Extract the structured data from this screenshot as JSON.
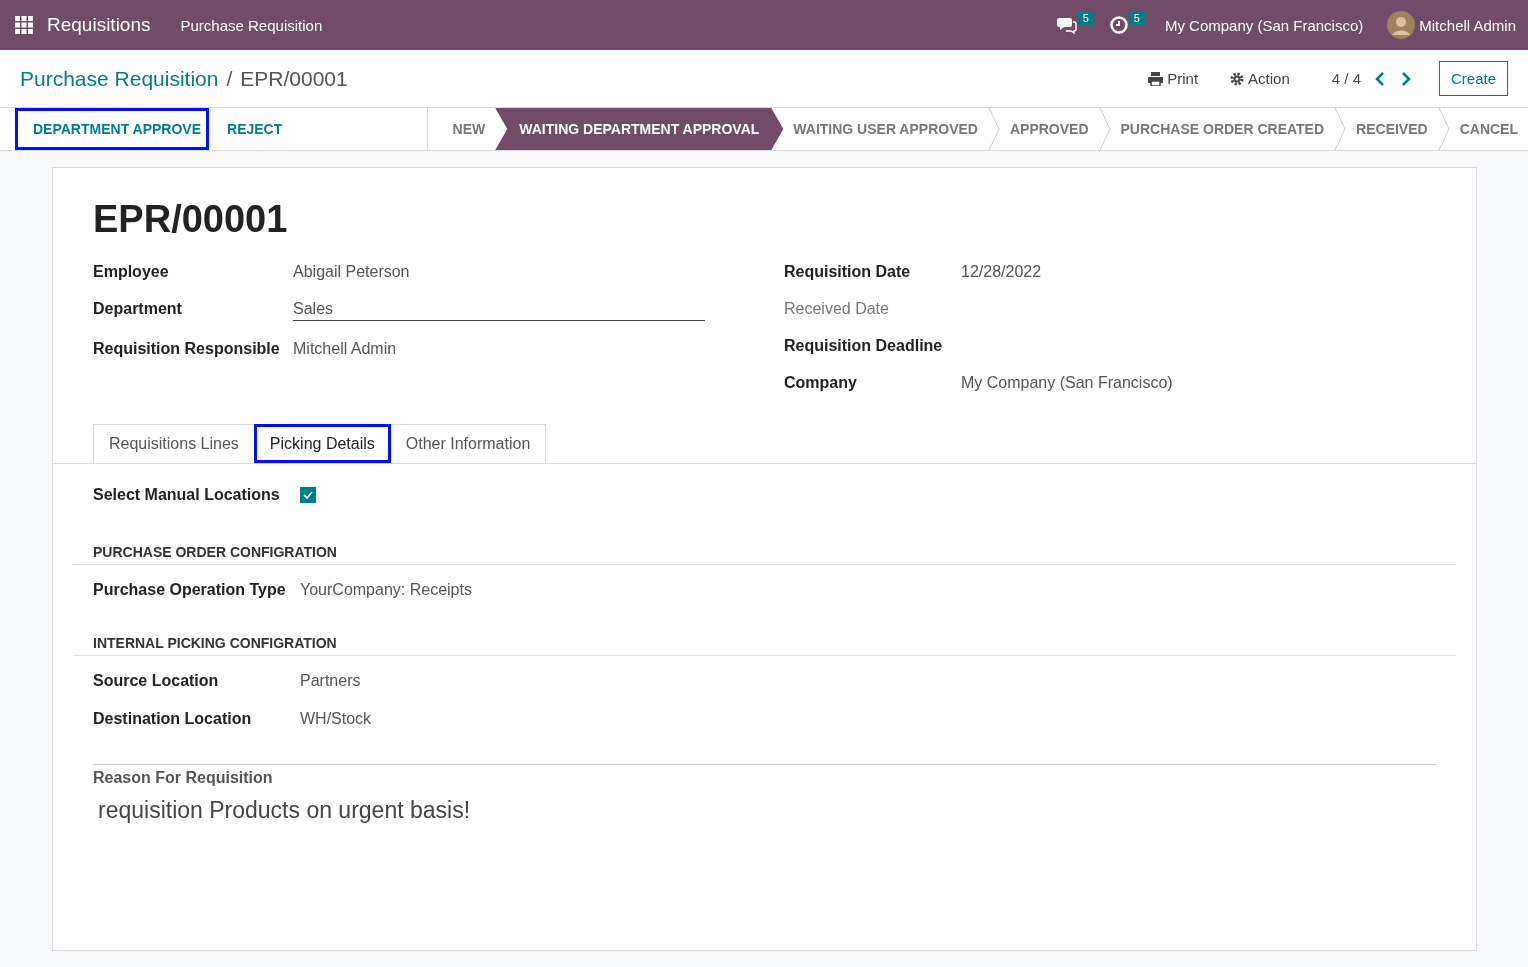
{
  "navbar": {
    "app": "Requisitions",
    "menu": [
      "Purchase Requisition"
    ],
    "messages_count": "5",
    "activities_count": "5",
    "company": "My Company (San Francisco)",
    "user": "Mitchell Admin"
  },
  "control_panel": {
    "breadcrumb": [
      {
        "label": "Purchase Requisition",
        "kind": "link"
      },
      {
        "label": "EPR/00001",
        "kind": "current"
      }
    ],
    "separator": "/",
    "print": "Print",
    "action": "Action",
    "pager": "4 / 4",
    "create": "Create"
  },
  "status_bar": {
    "buttons": [
      {
        "label": "DEPARTMENT APPROVE",
        "highlighted": true
      },
      {
        "label": "REJECT",
        "highlighted": false
      }
    ],
    "stages": [
      {
        "label": "NEW",
        "selected": false
      },
      {
        "label": "WAITING DEPARTMENT APPROVAL",
        "selected": true
      },
      {
        "label": "WAITING USER APPROVED",
        "selected": false
      },
      {
        "label": "APPROVED",
        "selected": false
      },
      {
        "label": "PURCHASE ORDER CREATED",
        "selected": false
      },
      {
        "label": "RECEIVED",
        "selected": false
      },
      {
        "label": "CANCEL",
        "selected": false
      }
    ]
  },
  "record": {
    "title": "EPR/00001",
    "left_fields": [
      {
        "label": "Employee",
        "value": "Abigail Peterson",
        "kind": "plain",
        "label_muted": false
      },
      {
        "label": "Department",
        "value": "Sales",
        "kind": "input",
        "label_muted": false
      },
      {
        "label": "Requisition Responsible",
        "value": "Mitchell Admin",
        "kind": "plain",
        "label_muted": false
      }
    ],
    "right_fields": [
      {
        "label": "Requisition Date",
        "value": "12/28/2022",
        "label_muted": false
      },
      {
        "label": "Received Date",
        "label_muted": true
      },
      {
        "label": "Requisition Deadline",
        "label_muted": false
      },
      {
        "label": "Company",
        "value": "My Company (San Francisco)",
        "label_muted": false
      }
    ],
    "tabs": [
      {
        "label": "Requisitions Lines",
        "selected": false,
        "highlighted": false
      },
      {
        "label": "Picking Details",
        "selected": true,
        "highlighted": true
      },
      {
        "label": "Other Information",
        "selected": false,
        "highlighted": false
      }
    ],
    "picking": {
      "manual_locations": {
        "label": "Select Manual Locations",
        "checked": true
      },
      "sections": [
        {
          "heading": "PURCHASE ORDER CONFIGRATION",
          "fields": [
            {
              "label": "Purchase Operation Type",
              "value": "YourCompany: Receipts"
            }
          ]
        },
        {
          "heading": "INTERNAL PICKING CONFIGRATION",
          "fields": [
            {
              "label": "Source Location",
              "value": "Partners"
            },
            {
              "label": "Destination Location",
              "value": "WH/Stock"
            }
          ]
        }
      ]
    },
    "reason": {
      "label": "Reason For Requisition",
      "text": "requisition Products on urgent basis!"
    }
  }
}
